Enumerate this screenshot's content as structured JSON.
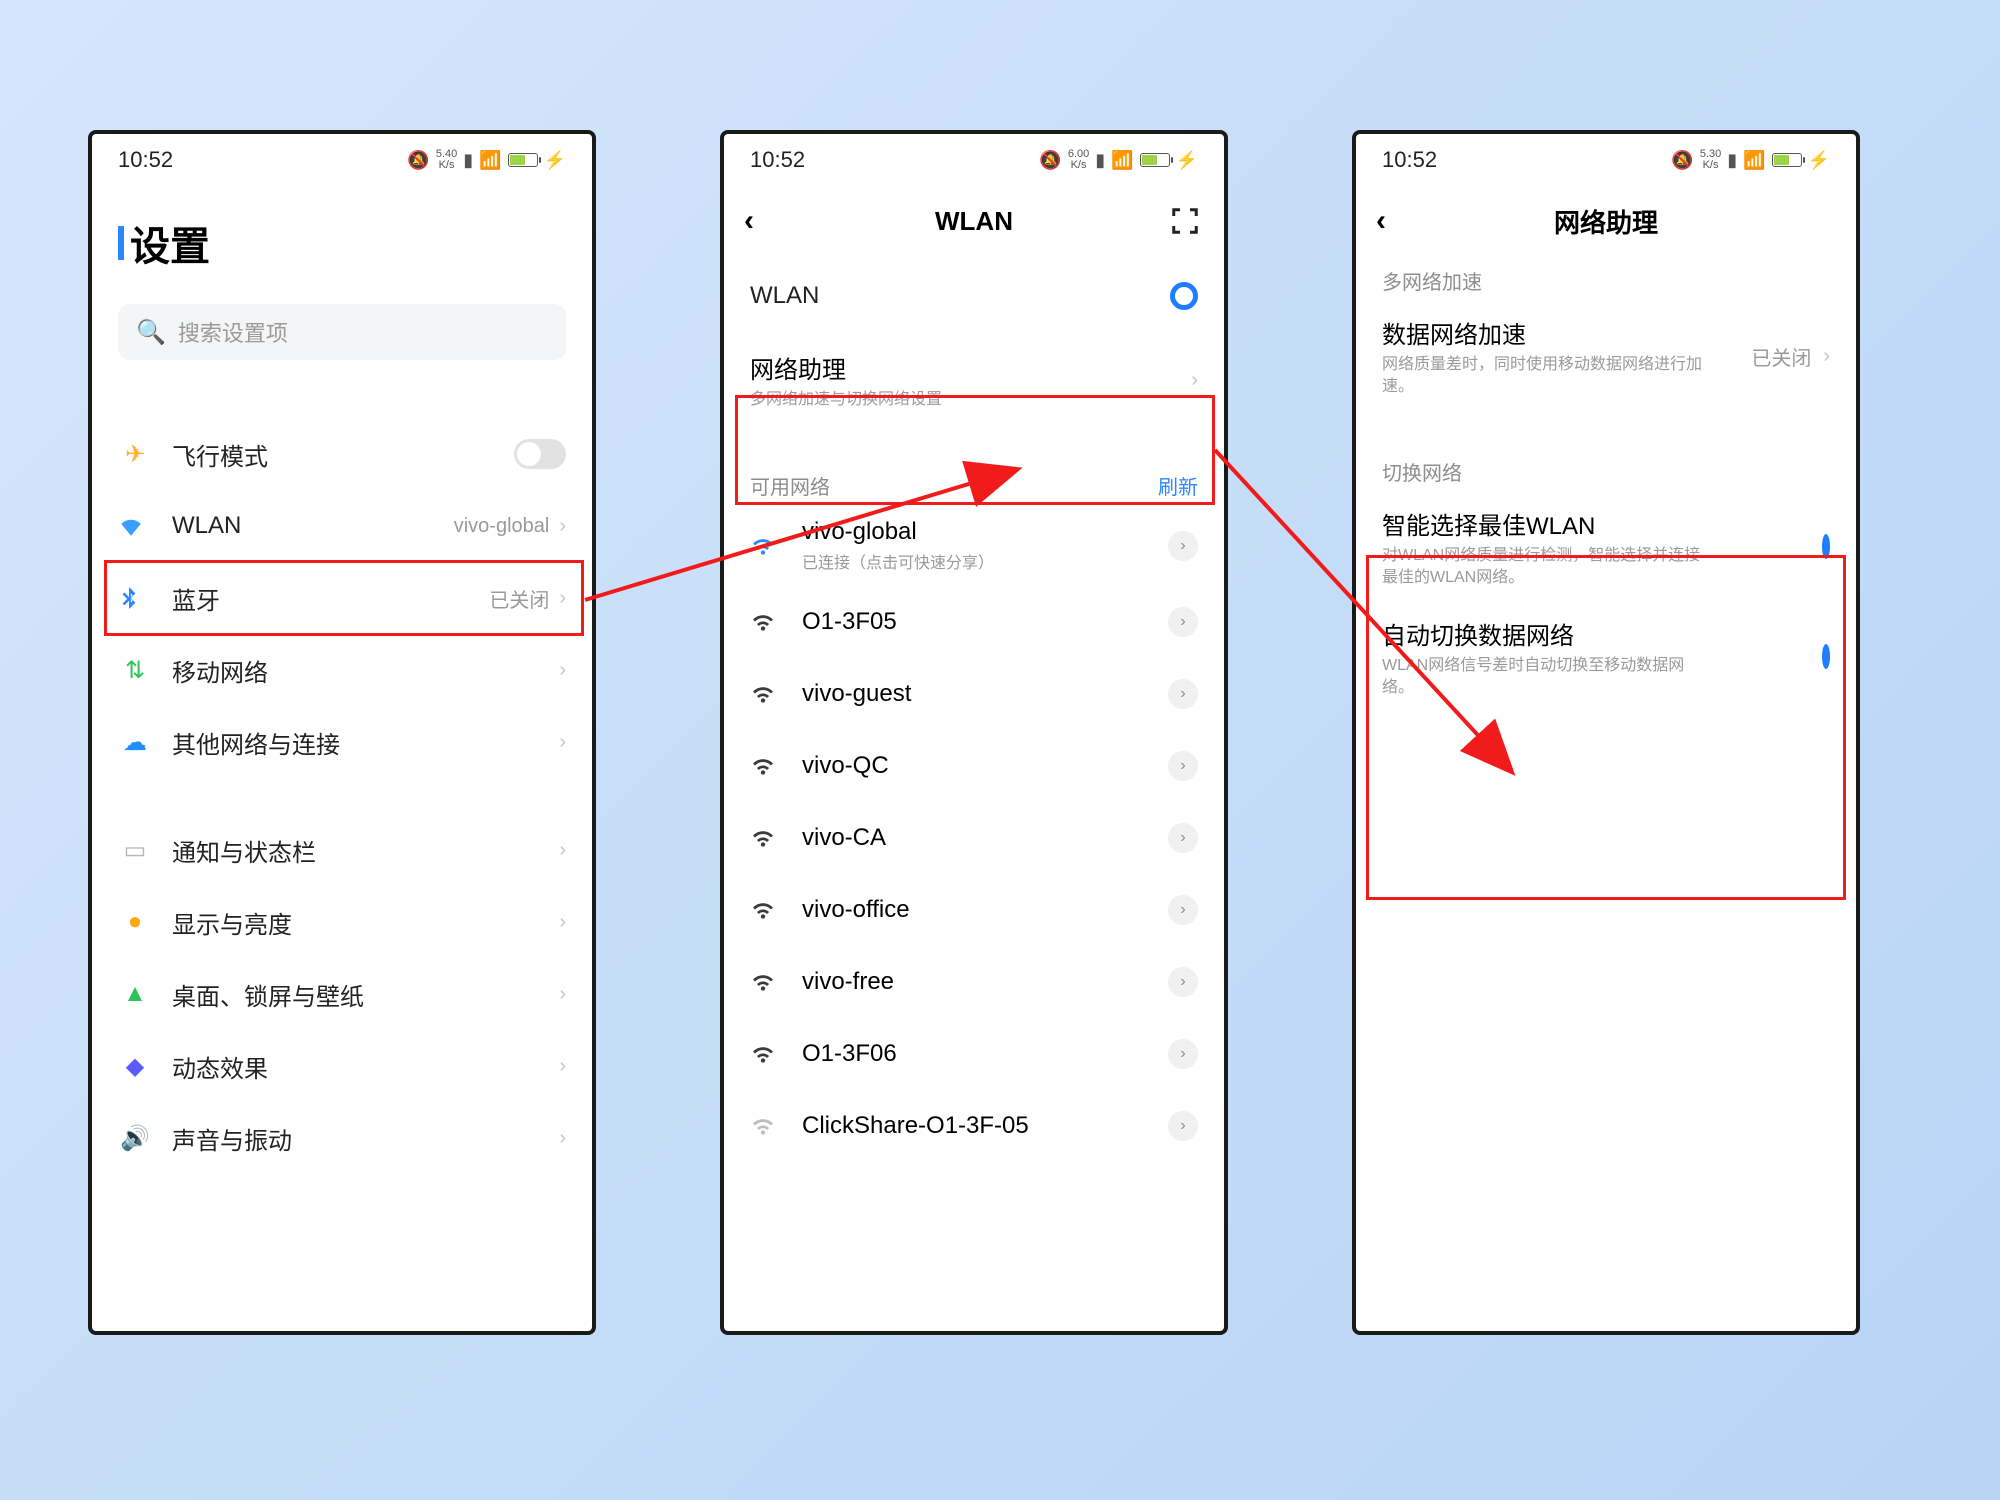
{
  "status": {
    "time": "10:52",
    "kbs1": "5.40",
    "kbs2": "6.00",
    "kbs3": "5.30",
    "kbs_unit": "K/s"
  },
  "p1": {
    "title": "设置",
    "search_placeholder": "搜索设置项",
    "rows": {
      "airplane": "飞行模式",
      "wlan": "WLAN",
      "wlan_value": "vivo-global",
      "bluetooth": "蓝牙",
      "bluetooth_value": "已关闭",
      "mobile": "移动网络",
      "other_net": "其他网络与连接",
      "notif": "通知与状态栏",
      "display": "显示与亮度",
      "desktop": "桌面、锁屏与壁纸",
      "anim": "动态效果",
      "sound": "声音与振动"
    }
  },
  "p2": {
    "title": "WLAN",
    "wlan_row": "WLAN",
    "assistant_title": "网络助理",
    "assistant_sub": "多网络加速与切换网络设置",
    "available_label": "可用网络",
    "refresh": "刷新",
    "nets": [
      {
        "ssid": "vivo-global",
        "sub": "已连接（点击可快速分享）",
        "blue": true
      },
      {
        "ssid": "O1-3F05"
      },
      {
        "ssid": "vivo-guest"
      },
      {
        "ssid": "vivo-QC"
      },
      {
        "ssid": "vivo-CA"
      },
      {
        "ssid": "vivo-office"
      },
      {
        "ssid": "vivo-free"
      },
      {
        "ssid": "O1-3F06"
      },
      {
        "ssid": "ClickShare-O1-3F-05",
        "weak": true
      }
    ]
  },
  "p3": {
    "title": "网络助理",
    "sec1": "多网络加速",
    "data_accel_title": "数据网络加速",
    "data_accel_desc": "网络质量差时，同时使用移动数据网络进行加速。",
    "data_accel_value": "已关闭",
    "sec2": "切换网络",
    "smart_title": "智能选择最佳WLAN",
    "smart_desc": "对WLAN网络质量进行检测，智能选择并连接最佳的WLAN网络。",
    "auto_title": "自动切换数据网络",
    "auto_desc": "WLAN网络信号差时自动切换至移动数据网络。"
  }
}
